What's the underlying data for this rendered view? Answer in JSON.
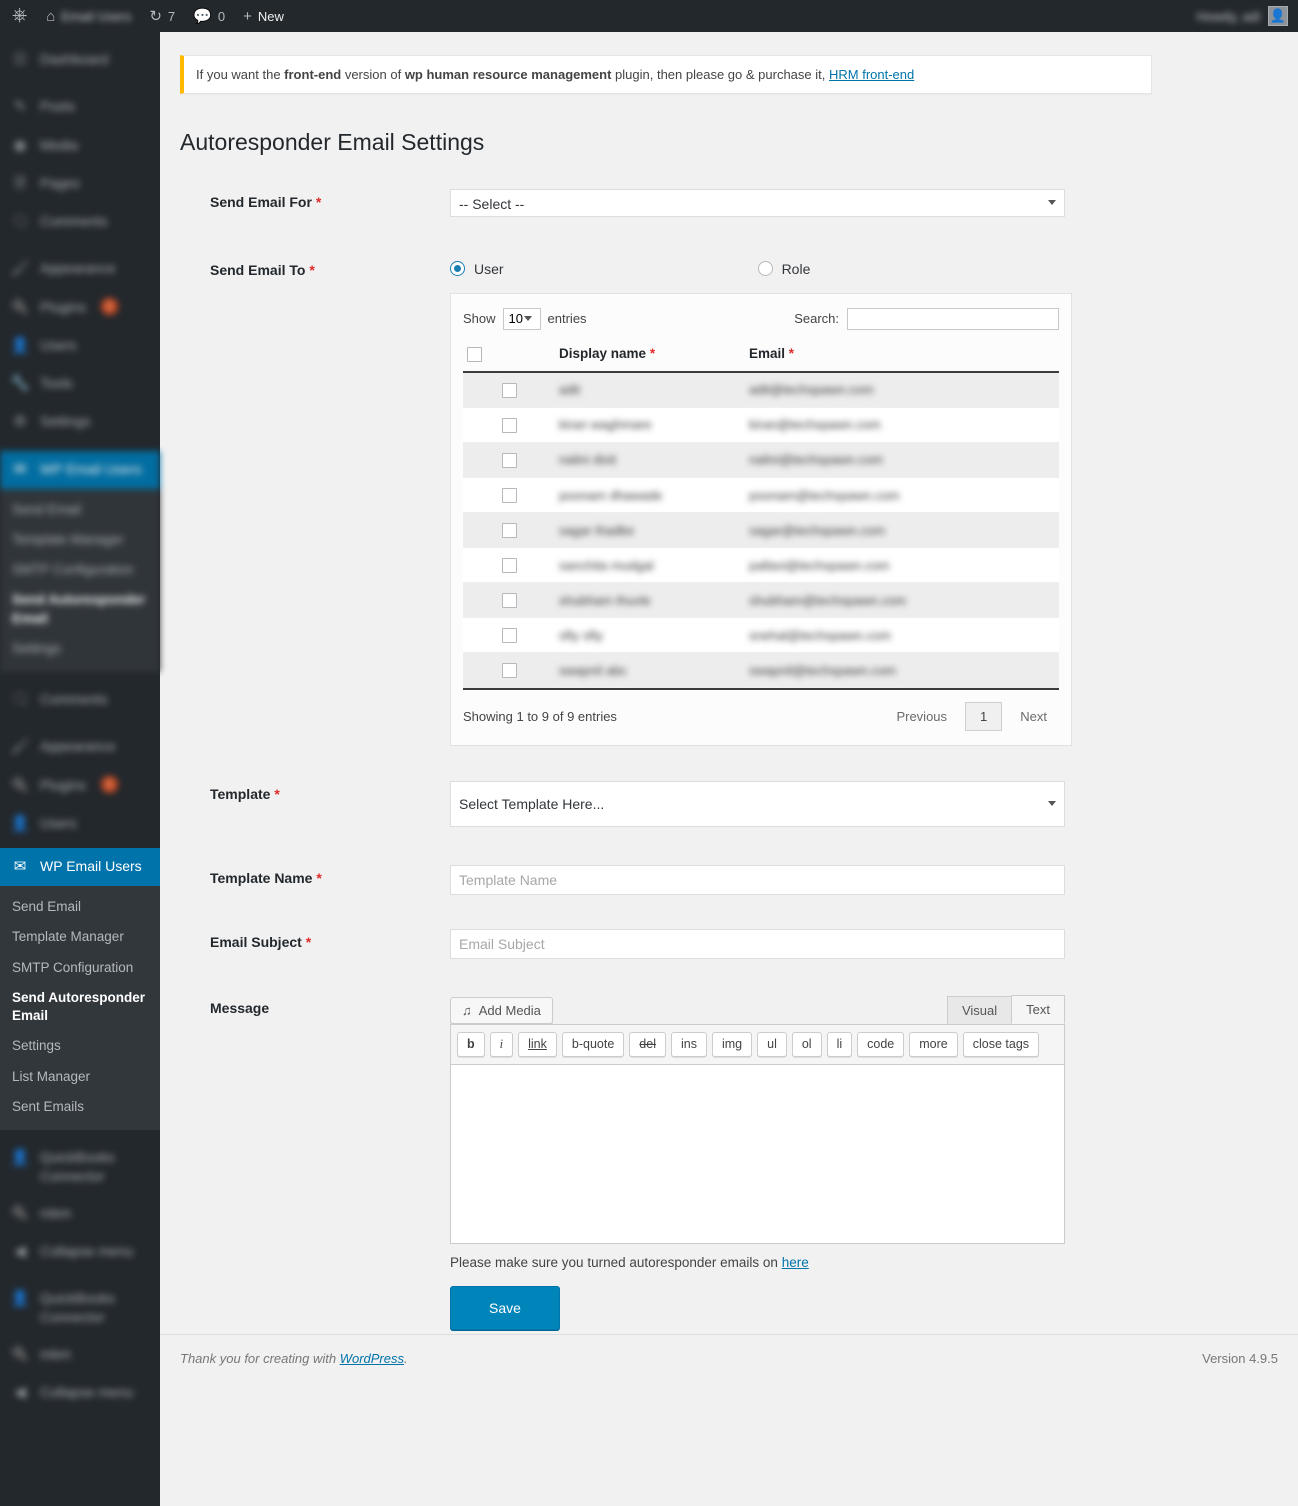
{
  "adminbar": {
    "wp_logo_icon": "wordpress-logo-icon",
    "home_icon": "home-icon",
    "site_name": "Email Users",
    "updates_icon": "updates-icon",
    "updates_count": "7",
    "comments_icon": "comments-icon",
    "comments_count": "0",
    "new_icon": "plus-icon",
    "new_label": "New",
    "howdy": "Howdy, adi",
    "avatar_icon": "avatar-icon"
  },
  "sidebar": {
    "items": [
      {
        "label": "Dashboard",
        "icon": "dashboard-icon"
      },
      {
        "label": "Posts",
        "icon": "pin-icon"
      },
      {
        "label": "Media",
        "icon": "media-icon"
      },
      {
        "label": "Pages",
        "icon": "page-icon"
      },
      {
        "label": "Comments",
        "icon": "comments-icon"
      },
      {
        "label": "Appearance",
        "icon": "brush-icon"
      },
      {
        "label": "Plugins",
        "icon": "plugins-icon",
        "badge": "1"
      },
      {
        "label": "Users",
        "icon": "users-icon"
      },
      {
        "label": "Tools",
        "icon": "tools-icon"
      },
      {
        "label": "Settings",
        "icon": "settings-icon"
      }
    ],
    "current": {
      "label": "WP Email Users",
      "icon": "envelope-icon"
    },
    "submenu": [
      {
        "label": "Send Email",
        "active": false
      },
      {
        "label": "Template Manager",
        "active": false
      },
      {
        "label": "SMTP Configuration",
        "active": false
      },
      {
        "label": "Send Autoresponder Email",
        "active": true
      },
      {
        "label": "Settings",
        "active": false
      },
      {
        "label": "List Manager",
        "active": false
      },
      {
        "label": "Sent Emails",
        "active": false
      }
    ],
    "bottom_items": [
      {
        "label": "QuickBooks Connector",
        "icon": "users-icon"
      },
      {
        "label": "mbm",
        "icon": "plugin-icon"
      },
      {
        "label": "Collapse menu",
        "icon": "collapse-icon"
      }
    ]
  },
  "notice": {
    "text_1": "If you want the ",
    "bold_1": "front-end",
    "text_2": " version of ",
    "bold_2": "wp human resource management",
    "text_3": " plugin, then please go & purchase it, ",
    "link": "HRM front-end",
    "accent_color": "#ffb900"
  },
  "page": {
    "title": "Autoresponder Email Settings"
  },
  "form": {
    "send_email_for": {
      "label": "Send Email For",
      "required": "*",
      "value": "-- Select --"
    },
    "send_email_to": {
      "label": "Send Email To",
      "required": "*",
      "options": [
        {
          "label": "User",
          "selected": true
        },
        {
          "label": "Role",
          "selected": false
        }
      ]
    },
    "template": {
      "label": "Template",
      "required": "*",
      "value": "Select Template Here..."
    },
    "template_name": {
      "label": "Template Name",
      "required": "*",
      "placeholder": "Template Name",
      "value": ""
    },
    "email_subject": {
      "label": "Email Subject",
      "required": "*",
      "placeholder": "Email Subject",
      "value": ""
    },
    "message": {
      "label": "Message"
    }
  },
  "datatable": {
    "show_label": "Show",
    "entries_label": "entries",
    "page_length": "10",
    "search_label": "Search:",
    "search_value": "",
    "columns": [
      "",
      "Display name",
      "Email"
    ],
    "col_required": "*",
    "rows": [
      {
        "name": "adit",
        "email": "adit@techspawn.com"
      },
      {
        "name": "kiran waghmare",
        "email": "kiran@techspawn.com"
      },
      {
        "name": "nalini dixit",
        "email": "nalini@techspawn.com"
      },
      {
        "name": "poonam dhawade",
        "email": "poonam@techspawn.com"
      },
      {
        "name": "sagar thadke",
        "email": "sagar@techspawn.com"
      },
      {
        "name": "sanchita mudgal",
        "email": "pallavi@techspawn.com"
      },
      {
        "name": "shubham thuvle",
        "email": "shubham@techspawn.com"
      },
      {
        "name": "sfty sfty",
        "email": "snehal@techspawn.com"
      },
      {
        "name": "swapnil abc",
        "email": "swapnil@techspawn.com"
      }
    ],
    "info": "Showing 1 to 9 of 9 entries",
    "previous": "Previous",
    "page_number": "1",
    "next": "Next"
  },
  "editor": {
    "add_media": "Add Media",
    "add_media_icon": "media-icon",
    "tab_visual": "Visual",
    "tab_text": "Text",
    "active_tab": "Text",
    "quicktags": [
      "b",
      "i",
      "link",
      "b-quote",
      "del",
      "ins",
      "img",
      "ul",
      "ol",
      "li",
      "code",
      "more",
      "close tags"
    ],
    "content": "",
    "note_text": "Please make sure you turned autoresponder emails on ",
    "note_link": "here",
    "save_label": "Save",
    "save_color": "#0085ba"
  },
  "footer": {
    "thanks_text": "Thank you for creating with ",
    "wp_link": "WordPress",
    "period": ".",
    "version": "Version 4.9.5"
  }
}
